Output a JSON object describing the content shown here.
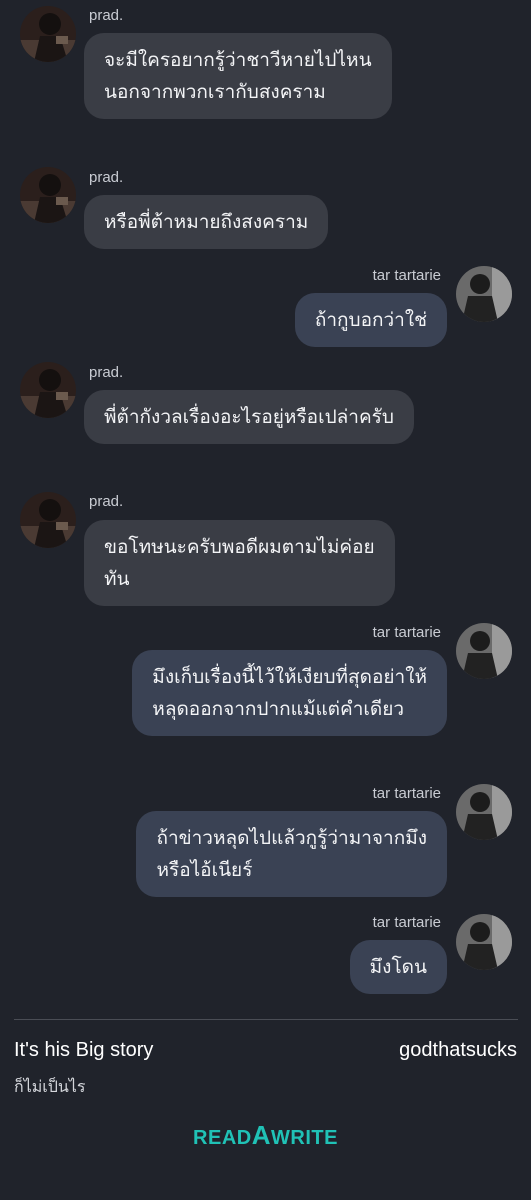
{
  "chat": {
    "messages": [
      {
        "sender": "prad.",
        "side": "left",
        "lines": [
          "จะมีใครอยากรู้ว่าชาวีหายไปไหน",
          "นอกจากพวกเรากับสงคราม"
        ]
      },
      {
        "sender": "prad.",
        "side": "left",
        "lines": [
          "หรือพี่ต้าหมายถึงสงคราม"
        ]
      },
      {
        "sender": "tar tartarie",
        "side": "right",
        "lines": [
          "ถ้ากูบอกว่าใช่"
        ]
      },
      {
        "sender": "prad.",
        "side": "left",
        "lines": [
          "พี่ต้ากังวลเรื่องอะไรอยู่หรือเปล่าครับ"
        ]
      },
      {
        "sender": "prad.",
        "side": "left",
        "lines": [
          "ขอโทษนะครับพอดีผมตามไม่ค่อย",
          "ทัน"
        ]
      },
      {
        "sender": "tar tartarie",
        "side": "right",
        "lines": [
          "มึงเก็บเรื่องนี้ไว้ให้เงียบที่สุดอย่าให้",
          "หลุดออกจากปากแม้แต่คำเดียว"
        ]
      },
      {
        "sender": "tar tartarie",
        "side": "right",
        "lines": [
          "ถ้าข่าวหลุดไปแล้วกูรู้ว่ามาจากมึง",
          "หรือไอ้เนียร์"
        ]
      },
      {
        "sender": "tar tartarie",
        "side": "right",
        "lines": [
          "มึงโดน"
        ]
      }
    ]
  },
  "footer": {
    "story_title": "It's his Big story",
    "author": "godthatsucks",
    "subtitle": "ก็ไม่เป็นไร",
    "logo": {
      "part1": "READ",
      "part2": "A",
      "part3": "WRITE"
    }
  },
  "colors": {
    "background": "#20232b",
    "incoming_bubble": "#3a3d45",
    "outgoing_bubble": "#3a4254",
    "brand": "#20c2b6"
  }
}
